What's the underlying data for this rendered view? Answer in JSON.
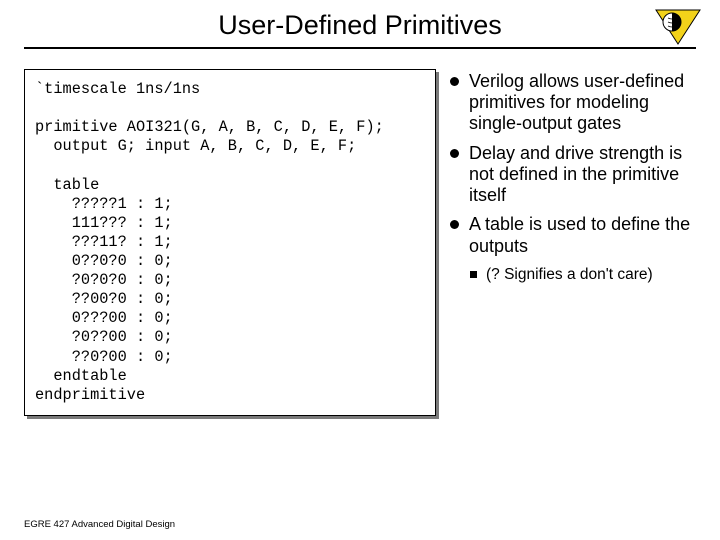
{
  "title": "User-Defined Primitives",
  "code": "`timescale 1ns/1ns\n\nprimitive AOI321(G, A, B, C, D, E, F);\n  output G; input A, B, C, D, E, F;\n\n  table\n    ?????1 : 1;\n    111??? : 1;\n    ???11? : 1;\n    0??0?0 : 0;\n    ?0?0?0 : 0;\n    ??00?0 : 0;\n    0???00 : 0;\n    ?0??00 : 0;\n    ??0?00 : 0;\n  endtable\nendprimitive",
  "bullets": [
    {
      "level": 1,
      "text": "Verilog allows user-defined primitives for modeling single-output gates"
    },
    {
      "level": 1,
      "text": "Delay and drive strength is not defined in the primitive itself"
    },
    {
      "level": 1,
      "text": "A table is used to define the outputs"
    },
    {
      "level": 2,
      "text": "(? Signifies a don't care)"
    }
  ],
  "footer": "EGRE 427 Advanced Digital Design"
}
